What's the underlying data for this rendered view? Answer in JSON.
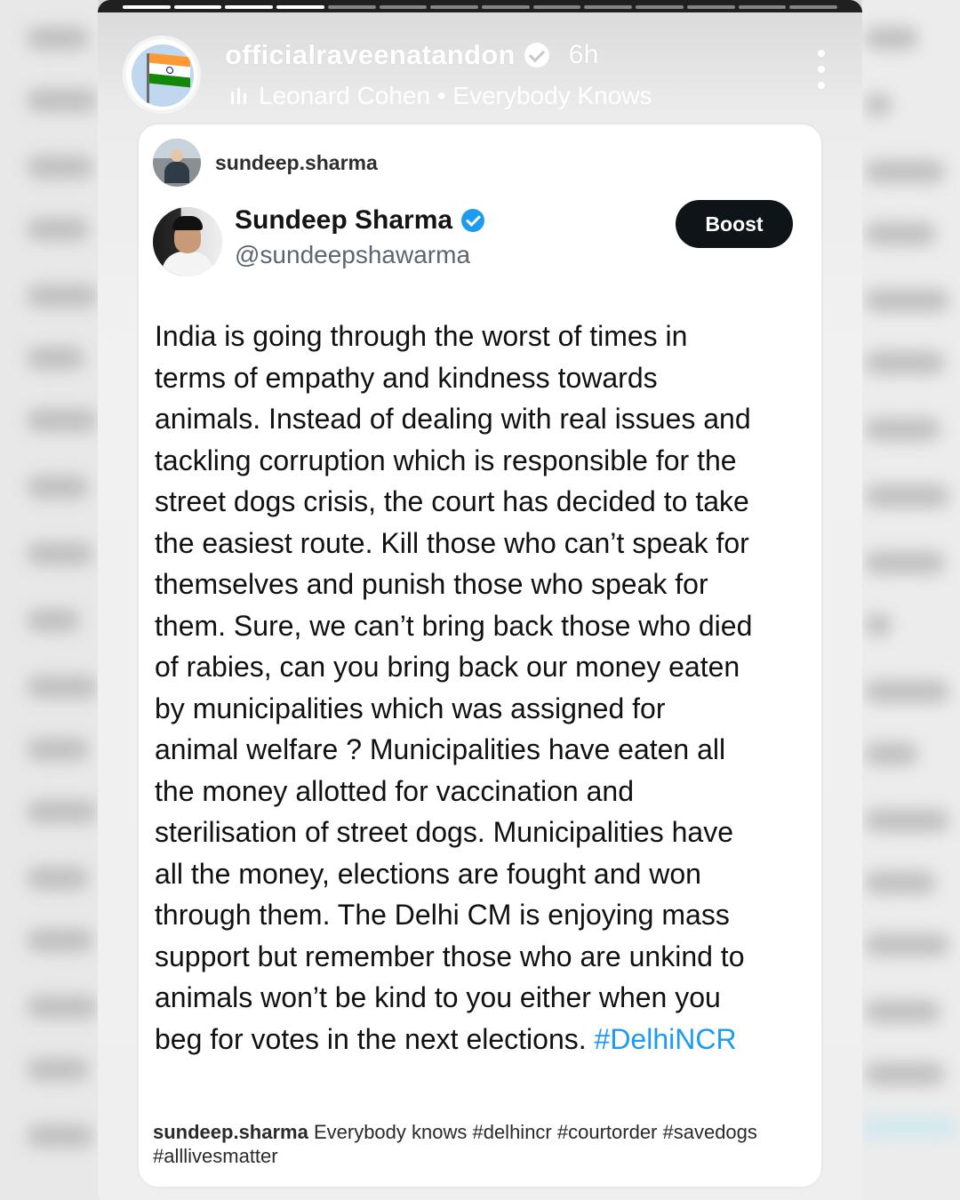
{
  "story": {
    "username": "officialraveenatandon",
    "time": "6h",
    "music": "Leonard Cohen • Everybody Knows",
    "progress": {
      "segments": 14,
      "completed": 4
    }
  },
  "card": {
    "username": "sundeep.sharma",
    "tweet": {
      "name": "Sundeep Sharma",
      "handle": "@sundeepshawarma",
      "boost_label": "Boost",
      "lines": [
        "India is going through the worst of times in",
        "terms of empathy and kindness towards",
        "animals. Instead of dealing with real issues and",
        "tackling corruption which is responsible for the",
        "street dogs crisis, the court has decided to take",
        "the easiest route. Kill those who can’t speak for",
        "themselves and punish those who speak for",
        "them. Sure, we can’t bring back those who died",
        "of rabies, can you bring back our money eaten",
        "by municipalities which was assigned for",
        "animal welfare ? Municipalities have eaten all",
        "the money allotted for vaccination and",
        "sterilisation of street dogs. Municipalities have",
        "all the money, elections are fought and won",
        "through them. The Delhi CM is enjoying mass",
        "support but remember those who are unkind to",
        "animals won’t be kind to you either when you",
        "beg for votes in the next elections. "
      ],
      "hashtag": "#DelhiNCR"
    },
    "caption": {
      "username": "sundeep.sharma",
      "text": " Everybody knows #delhincr #courtorder #savedogs #alllivesmatter"
    }
  },
  "colors": {
    "link": "#1d9bf0",
    "boost_bg": "#0f1419",
    "verified": "#1d9bf0"
  }
}
